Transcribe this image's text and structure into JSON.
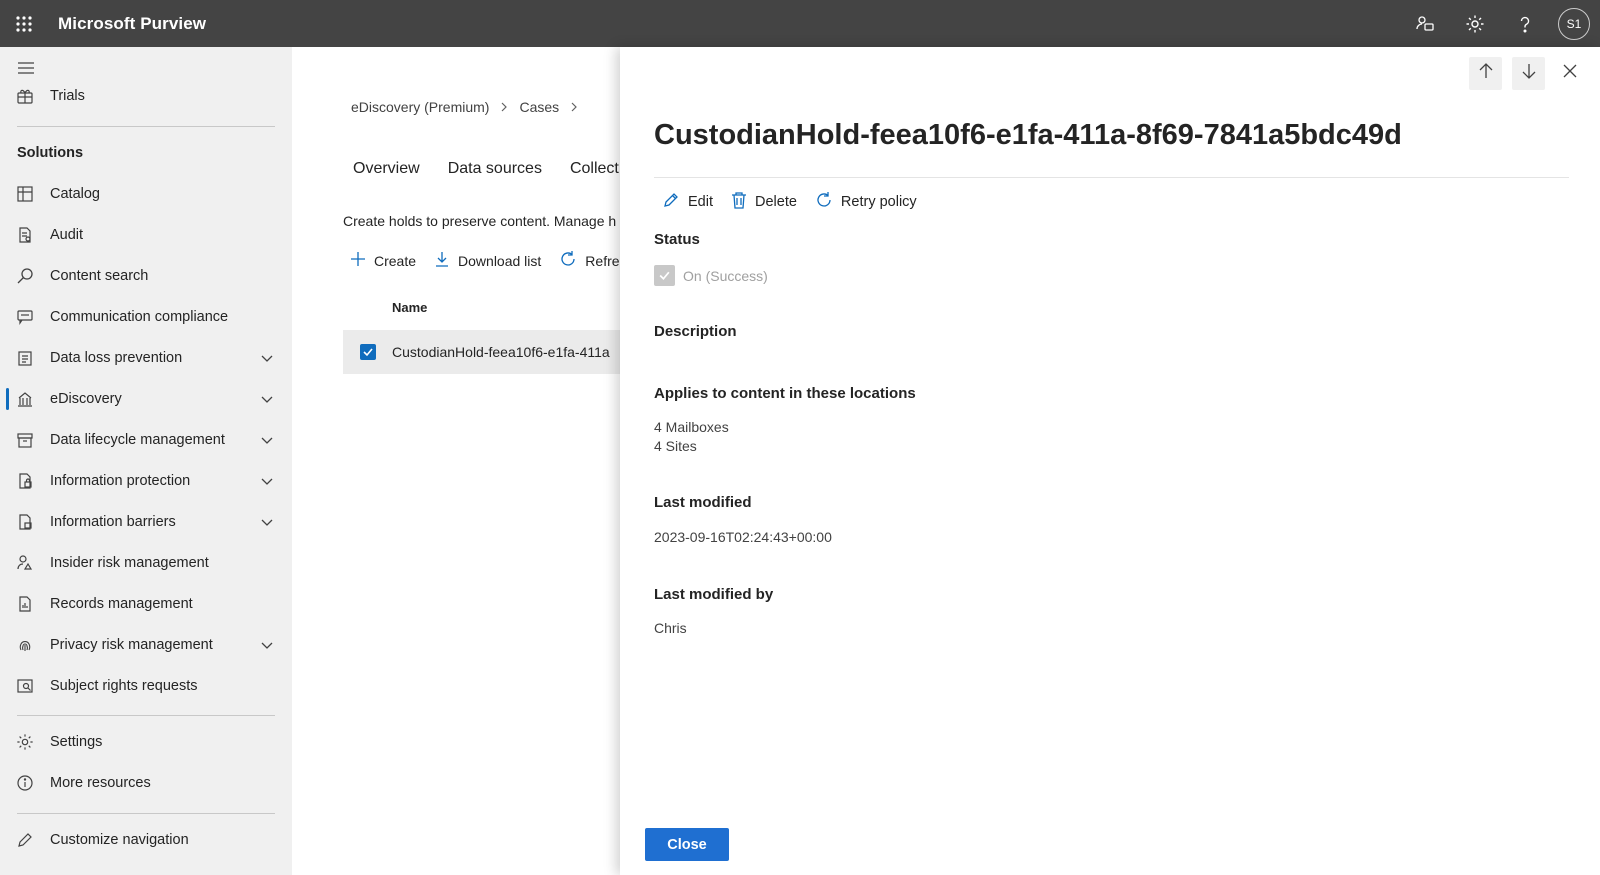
{
  "app": {
    "title": "Microsoft Purview",
    "avatar": "S1"
  },
  "nav": {
    "trials": "Trials",
    "solutions_header": "Solutions",
    "items": [
      {
        "label": "Catalog",
        "icon": "catalog-icon",
        "expandable": false
      },
      {
        "label": "Audit",
        "icon": "audit-icon",
        "expandable": false
      },
      {
        "label": "Content search",
        "icon": "search-icon",
        "expandable": false
      },
      {
        "label": "Communication compliance",
        "icon": "chat-icon",
        "expandable": false
      },
      {
        "label": "Data loss prevention",
        "icon": "shield-icon",
        "expandable": true
      },
      {
        "label": "eDiscovery",
        "icon": "ediscovery-icon",
        "expandable": true,
        "active": true
      },
      {
        "label": "Data lifecycle management",
        "icon": "archive-icon",
        "expandable": true
      },
      {
        "label": "Information protection",
        "icon": "lock-document-icon",
        "expandable": true
      },
      {
        "label": "Information barriers",
        "icon": "barrier-icon",
        "expandable": true
      },
      {
        "label": "Insider risk management",
        "icon": "person-warning-icon",
        "expandable": false
      },
      {
        "label": "Records management",
        "icon": "records-icon",
        "expandable": false
      },
      {
        "label": "Privacy risk management",
        "icon": "fingerprint-icon",
        "expandable": true
      },
      {
        "label": "Subject rights requests",
        "icon": "person-search-icon",
        "expandable": false
      }
    ],
    "settings": "Settings",
    "more_resources": "More resources",
    "customize": "Customize navigation"
  },
  "main": {
    "breadcrumb": [
      "eDiscovery (Premium)",
      "Cases"
    ],
    "tabs": [
      "Overview",
      "Data sources",
      "Collect"
    ],
    "description": "Create holds to preserve content. Manage h",
    "commands": {
      "create": "Create",
      "download": "Download list",
      "refresh": "Refre"
    },
    "column_name": "Name",
    "row_name": "CustodianHold-feea10f6-e1fa-411a"
  },
  "panel": {
    "title": "CustodianHold-feea10f6-e1fa-411a-8f69-7841a5bdc49d",
    "actions": {
      "edit": "Edit",
      "delete": "Delete",
      "retry": "Retry policy"
    },
    "status_label": "Status",
    "status_value": "On (Success)",
    "description_label": "Description",
    "locations_label": "Applies to content in these locations",
    "locations": [
      "4 Mailboxes",
      "4 Sites"
    ],
    "last_modified_label": "Last modified",
    "last_modified_value": "2023-09-16T02:24:43+00:00",
    "last_modified_by_label": "Last modified by",
    "last_modified_by_value": "Chris",
    "close_label": "Close"
  },
  "colors": {
    "topbar": "#444444",
    "accent": "#0f6cbd",
    "close_button": "#1f6fd1"
  }
}
